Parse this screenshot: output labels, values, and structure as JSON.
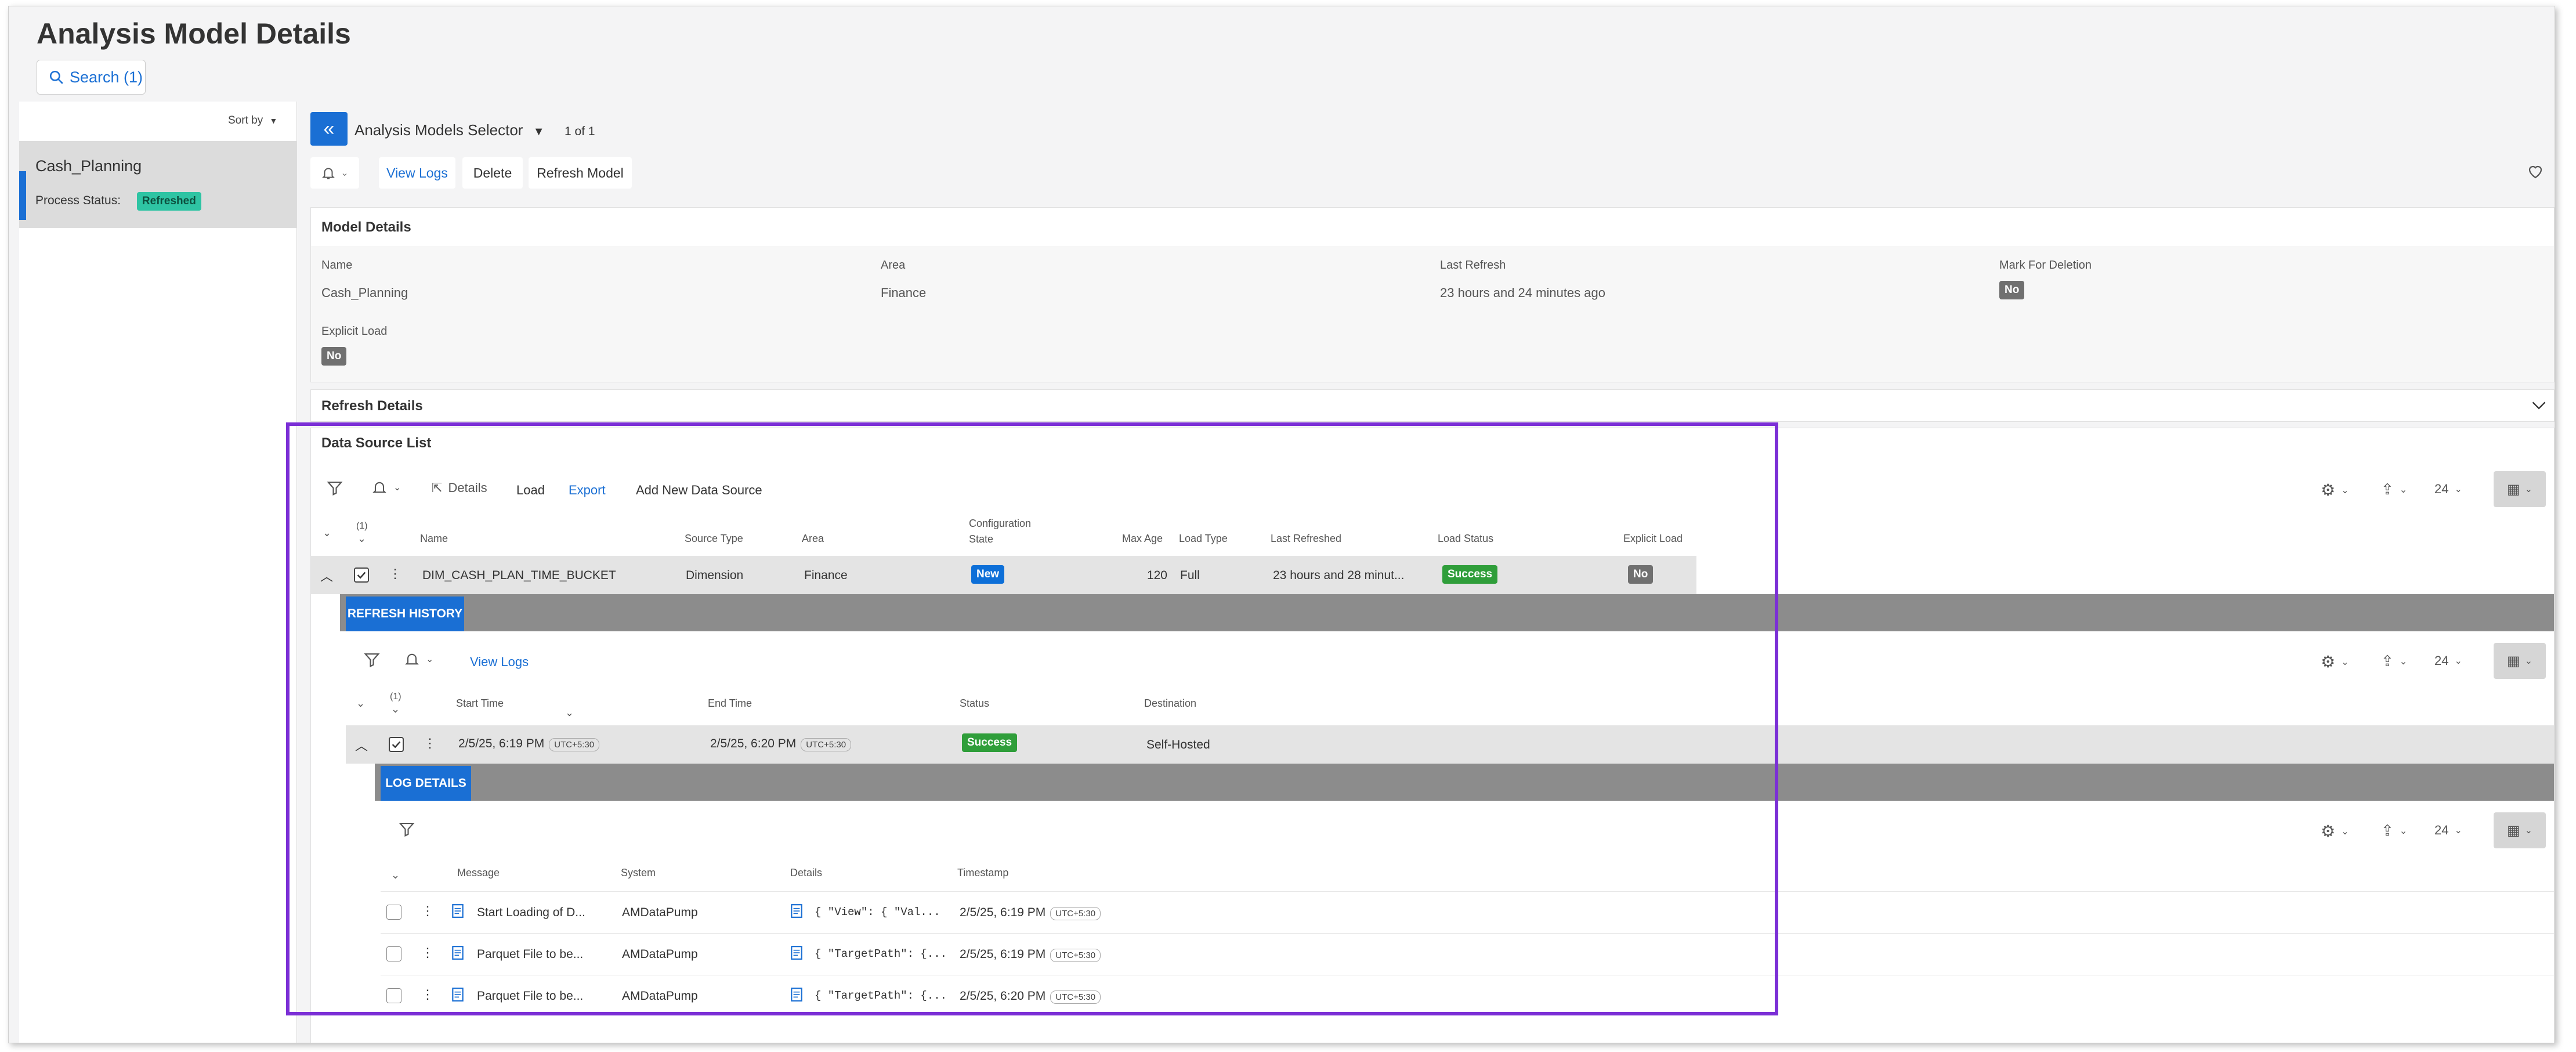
{
  "page": {
    "title": "Analysis Model Details"
  },
  "search": {
    "label": "Search (1)"
  },
  "left_panel": {
    "sort_label": "Sort by",
    "item": {
      "name": "Cash_Planning",
      "status_label": "Process Status:",
      "status_value": "Refreshed"
    }
  },
  "selector": {
    "label": "Analysis Models Selector",
    "count": "1 of 1"
  },
  "toolbar": {
    "view_logs": "View Logs",
    "delete": "Delete",
    "refresh_model": "Refresh Model"
  },
  "model_details": {
    "title": "Model Details",
    "fields": {
      "name_label": "Name",
      "name_value": "Cash_Planning",
      "area_label": "Area",
      "area_value": "Finance",
      "last_refresh_label": "Last Refresh",
      "last_refresh_value": "23 hours and 24 minutes ago",
      "mark_label": "Mark For Deletion",
      "mark_value": "No",
      "explicit_label": "Explicit Load",
      "explicit_value": "No"
    }
  },
  "refresh_details": {
    "title": "Refresh Details"
  },
  "data_source_list": {
    "title": "Data Source List",
    "actions": {
      "details": "Details",
      "load": "Load",
      "export": "Export",
      "add": "Add New Data Source"
    },
    "page_size": "24",
    "count": "(1)",
    "headers": {
      "name": "Name",
      "source_type": "Source Type",
      "area": "Area",
      "config_state_1": "Configuration",
      "config_state_2": "State",
      "max_age": "Max Age",
      "load_type": "Load Type",
      "last_refreshed": "Last Refreshed",
      "load_status": "Load Status",
      "explicit_load": "Explicit Load"
    },
    "row": {
      "name": "DIM_CASH_PLAN_TIME_BUCKET",
      "source_type": "Dimension",
      "area": "Finance",
      "config_state": "New",
      "max_age": "120",
      "load_type": "Full",
      "last_refreshed": "23 hours  and 28 minut...",
      "load_status": "Success",
      "explicit_load": "No"
    }
  },
  "refresh_history": {
    "tab": "REFRESH HISTORY",
    "view_logs": "View Logs",
    "page_size": "24",
    "count": "(1)",
    "headers": {
      "start": "Start Time",
      "end": "End Time",
      "status": "Status",
      "destination": "Destination"
    },
    "row": {
      "start": "2/5/25, 6:19 PM",
      "start_tz": "UTC+5:30",
      "end": "2/5/25, 6:20 PM",
      "end_tz": "UTC+5:30",
      "status": "Success",
      "destination": "Self-Hosted"
    }
  },
  "log_details": {
    "tab": "LOG DETAILS",
    "page_size": "24",
    "headers": {
      "message": "Message",
      "system": "System",
      "details": "Details",
      "timestamp": "Timestamp"
    },
    "rows": [
      {
        "message": "Start Loading of D...",
        "system": "AMDataPump",
        "details": "{  \"View\": {    \"Val...",
        "timestamp": "2/5/25, 6:19 PM",
        "tz": "UTC+5:30"
      },
      {
        "message": "Parquet File to be...",
        "system": "AMDataPump",
        "details": "{  \"TargetPath\": {...",
        "timestamp": "2/5/25, 6:19 PM",
        "tz": "UTC+5:30"
      },
      {
        "message": "Parquet File to be...",
        "system": "AMDataPump",
        "details": "{  \"TargetPath\": {...",
        "timestamp": "2/5/25, 6:20 PM",
        "tz": "UTC+5:30"
      }
    ]
  },
  "colors": {
    "accent": "#1a6fd4",
    "highlight": "#7b2fd6",
    "success": "#2f9e3a",
    "refreshed": "#2ec4a3"
  }
}
